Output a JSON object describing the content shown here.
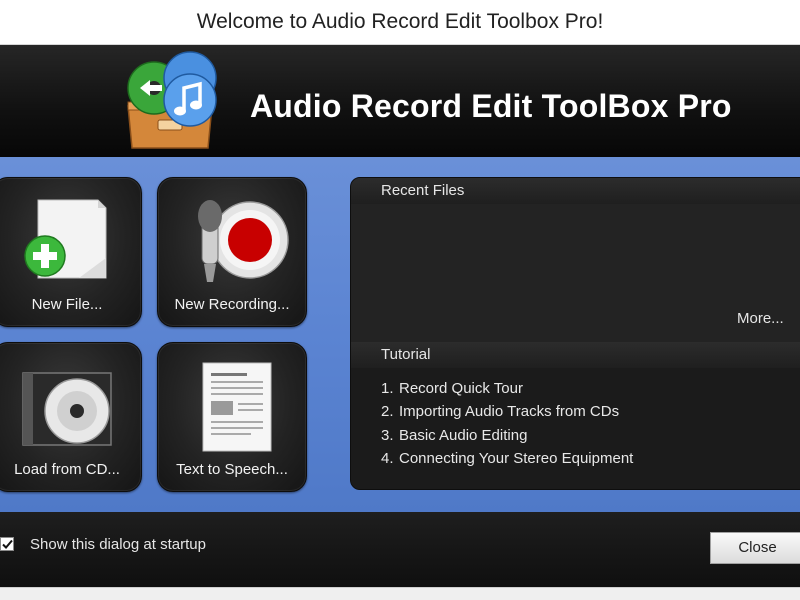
{
  "window": {
    "title": "Welcome to Audio Record Edit Toolbox Pro!"
  },
  "header": {
    "app_name": "Audio Record Edit ToolBox Pro",
    "logo_icon": "app-logo-icon"
  },
  "tiles": [
    {
      "label": "New File...",
      "icon": "new-file-icon"
    },
    {
      "label": "New Recording...",
      "icon": "microphone-record-icon"
    },
    {
      "label": "Load from CD...",
      "icon": "cd-case-icon"
    },
    {
      "label": "Text to Speech...",
      "icon": "document-icon"
    }
  ],
  "recent_files": {
    "heading": "Recent Files",
    "more_label": "More..."
  },
  "tutorial": {
    "heading": "Tutorial",
    "items": [
      {
        "num": "1.",
        "label": "Record Quick Tour"
      },
      {
        "num": "2.",
        "label": "Importing Audio Tracks from CDs"
      },
      {
        "num": "3.",
        "label": "Basic Audio Editing"
      },
      {
        "num": "4.",
        "label": "Connecting Your Stereo Equipment"
      }
    ]
  },
  "footer": {
    "startup_label": "Show this dialog at startup",
    "startup_checked": true,
    "close_label": "Close"
  },
  "colors": {
    "panel_blue": "#5b84d2",
    "tile_dark": "#232323",
    "record_red": "#cc0000",
    "plus_green": "#3cb83c"
  }
}
